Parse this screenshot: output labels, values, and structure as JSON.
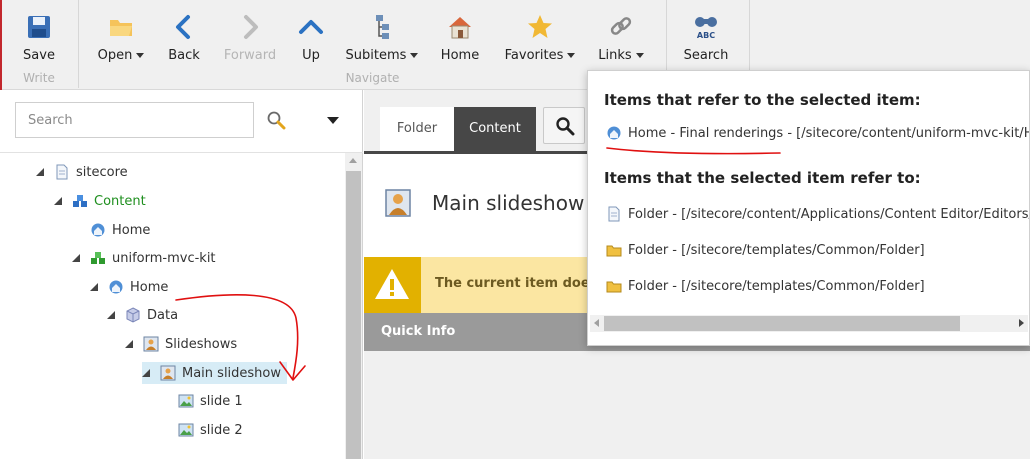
{
  "ribbon": {
    "write_group": "Write",
    "navigate_group": "Navigate",
    "buttons": {
      "save": "Save",
      "open": "Open",
      "back": "Back",
      "forward": "Forward",
      "up": "Up",
      "subitems": "Subitems",
      "home": "Home",
      "favorites": "Favorites",
      "links": "Links",
      "search": "Search"
    },
    "search_icon_text": "ABC"
  },
  "left": {
    "search_placeholder": "Search",
    "tree": [
      {
        "label": "sitecore",
        "icon": "document-icon"
      },
      {
        "label": "Content",
        "icon": "content-cubes-icon"
      },
      {
        "label": "Home",
        "icon": "home-globe-icon"
      },
      {
        "label": "uniform-mvc-kit",
        "icon": "site-cubes-icon"
      },
      {
        "label": "Home",
        "icon": "home-globe-icon"
      },
      {
        "label": "Data",
        "icon": "data-cube-icon"
      },
      {
        "label": "Slideshows",
        "icon": "slideshow-icon"
      },
      {
        "label": "Main slideshow",
        "icon": "slideshow-icon"
      },
      {
        "label": "slide 1",
        "icon": "image-icon"
      },
      {
        "label": "slide 2",
        "icon": "image-icon"
      }
    ]
  },
  "right": {
    "tabs": {
      "folder": "Folder",
      "content": "Content"
    },
    "item_title": "Main slideshow",
    "warning": "The current item does no",
    "quick_info": "Quick Info"
  },
  "popup": {
    "refer_to_heading": "Items that refer to the selected item:",
    "refer_to": [
      {
        "text": "Home - Final renderings - [/sitecore/content/uniform-mvc-kit/Hom",
        "icon": "home-globe-icon"
      }
    ],
    "refer_from_heading": "Items that the selected item refer to:",
    "refer_from": [
      {
        "text": "Folder - [/sitecore/content/Applications/Content Editor/Editors/Ite",
        "icon": "document-icon"
      },
      {
        "text": "Folder - [/sitecore/templates/Common/Folder]",
        "icon": "folder-icon"
      },
      {
        "text": "Folder - [/sitecore/templates/Common/Folder]",
        "icon": "folder-icon"
      }
    ]
  },
  "colors": {
    "accent_blue": "#2b72c2",
    "annotation_red": "#e01010",
    "warning_yellow": "#fbe6a2",
    "content_tab": "#474747"
  }
}
